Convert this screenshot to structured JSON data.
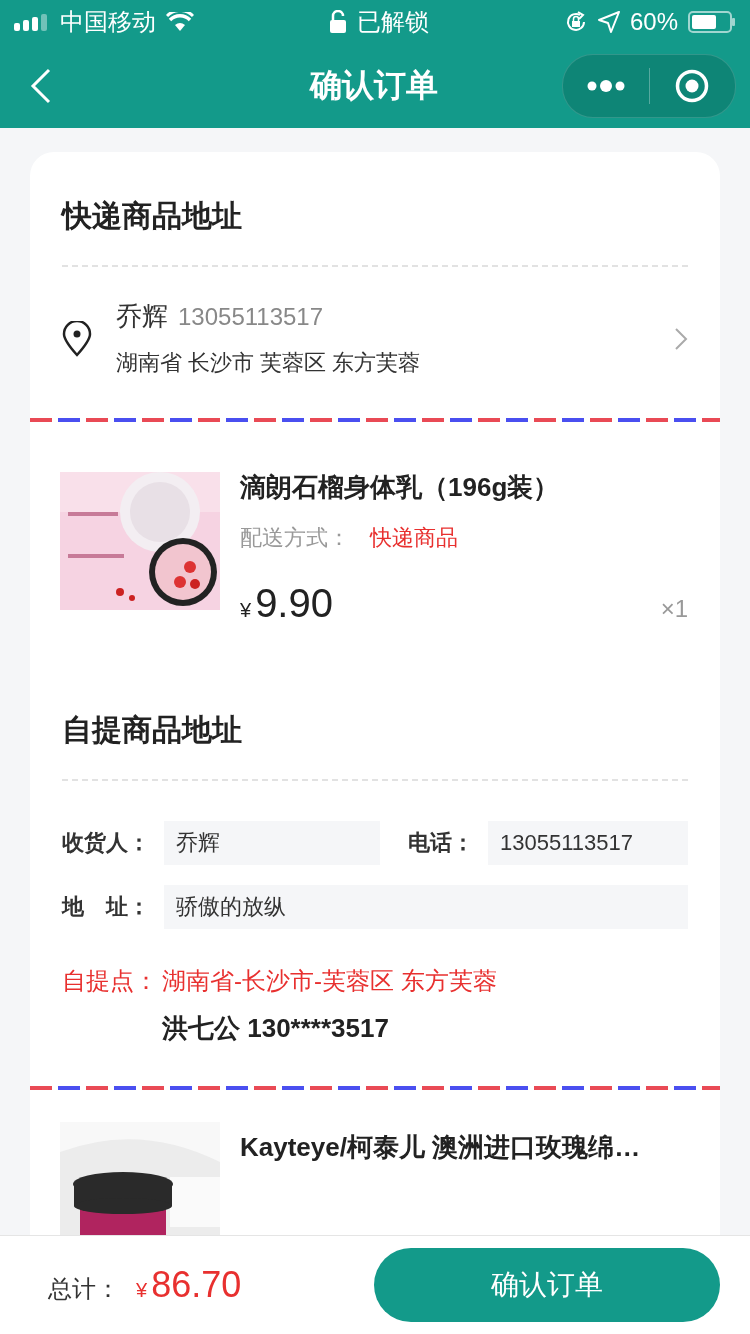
{
  "status_bar": {
    "carrier": "中国移动",
    "lock_text": "已解锁",
    "battery": "60%"
  },
  "nav": {
    "title": "确认订单"
  },
  "express": {
    "title": "快递商品地址",
    "name": "乔辉",
    "phone": "13055113517",
    "address": "湖南省 长沙市 芙蓉区 东方芙蓉"
  },
  "express_product": {
    "kind": "picture",
    "title": "滴朗石榴身体乳（196g装）",
    "delivery_label": "配送方式：",
    "delivery": "快递商品",
    "currency": "¥",
    "price": "9.90",
    "qty": "×1"
  },
  "pickup": {
    "title": "自提商品地址",
    "fields": [
      {
        "label": "收货人：",
        "value": "乔辉"
      },
      {
        "label": "电话：",
        "value": "13055113517"
      },
      {
        "label": "地　址：",
        "value": "骄傲的放纵"
      }
    ],
    "point_label": "自提点：",
    "point_address": "湖南省-长沙市-芙蓉区 东方芙蓉",
    "contact": "洪七公 130****3517"
  },
  "pickup_product": {
    "kind": "picture",
    "title": "Kayteye/柯泰儿 澳洲进口玫瑰绵…"
  },
  "footer": {
    "total_label": "总计：",
    "currency": "¥",
    "total": "86.70",
    "button": "确认订单"
  }
}
